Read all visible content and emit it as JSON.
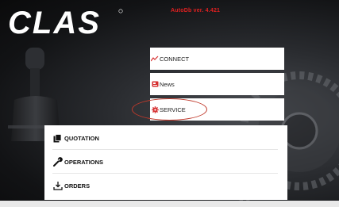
{
  "app": {
    "logo_text": "CLAS",
    "version": "AutoDb ver. 4.421"
  },
  "menu": {
    "connect": {
      "label": "CONNECT",
      "icon": "trend-line-icon"
    },
    "news": {
      "label": "News",
      "icon": "news-icon"
    },
    "service": {
      "label": "SERVICE",
      "icon": "gear-icon",
      "highlighted": true
    }
  },
  "panel": {
    "quotation": {
      "label": "QUOTATION",
      "icon": "copy-documents-icon"
    },
    "operations": {
      "label": "OPERATIONS",
      "icon": "wrench-icon"
    },
    "orders": {
      "label": "ORDERS",
      "icon": "download-tray-icon"
    }
  },
  "colors": {
    "accent_red": "#e02020",
    "highlight_ring": "#c0392b",
    "tile_bg": "#ffffff"
  }
}
